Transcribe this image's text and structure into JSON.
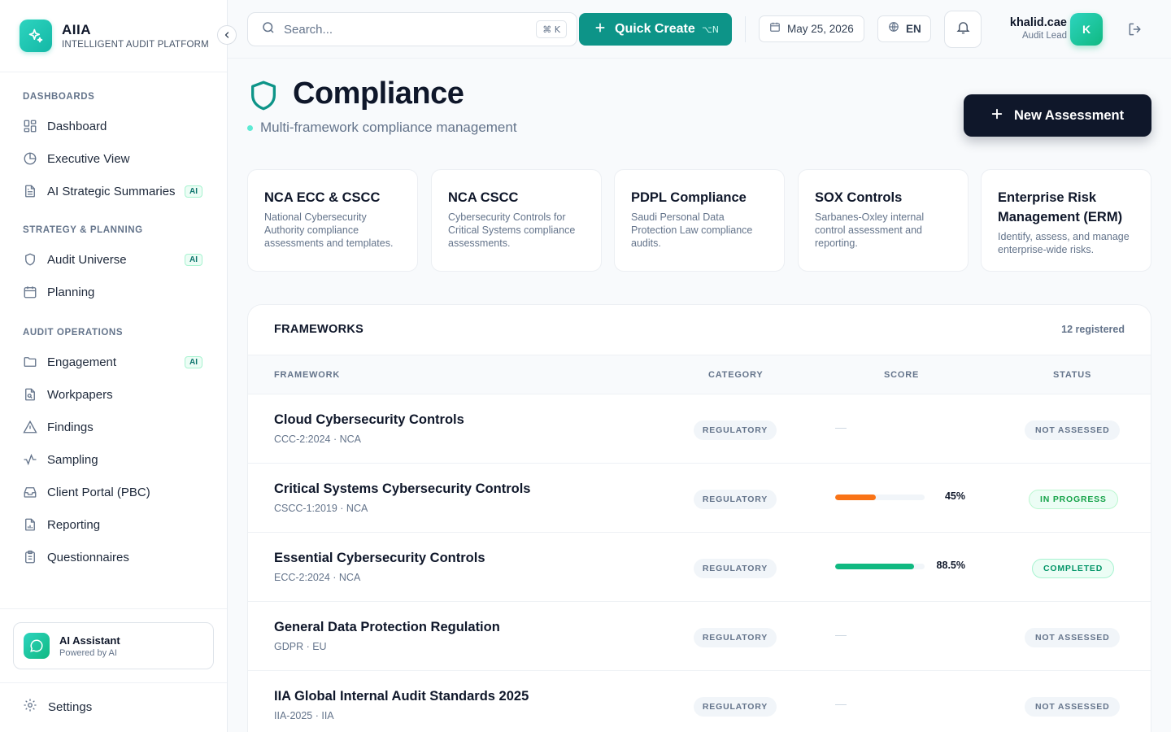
{
  "brand": {
    "name": "AIIA",
    "subtitle": "INTELLIGENT AUDIT PLATFORM"
  },
  "sidebar": {
    "sections": [
      {
        "title": "DASHBOARDS",
        "items": [
          {
            "label": "Dashboard",
            "icon": "grid-icon",
            "ai": false
          },
          {
            "label": "Executive View",
            "icon": "pie-chart-icon",
            "ai": false
          },
          {
            "label": "AI Strategic Summaries",
            "icon": "document-icon",
            "ai": true
          }
        ]
      },
      {
        "title": "STRATEGY & PLANNING",
        "items": [
          {
            "label": "Audit Universe",
            "icon": "shield-icon",
            "ai": true
          },
          {
            "label": "Planning",
            "icon": "calendar-icon",
            "ai": false
          }
        ]
      },
      {
        "title": "AUDIT OPERATIONS",
        "items": [
          {
            "label": "Engagement",
            "icon": "folder-icon",
            "ai": true
          },
          {
            "label": "Workpapers",
            "icon": "file-search-icon",
            "ai": false
          },
          {
            "label": "Findings",
            "icon": "warning-icon",
            "ai": false
          },
          {
            "label": "Sampling",
            "icon": "activity-icon",
            "ai": false
          },
          {
            "label": "Client Portal (PBC)",
            "icon": "inbox-icon",
            "ai": false
          },
          {
            "label": "Reporting",
            "icon": "report-icon",
            "ai": false
          },
          {
            "label": "Questionnaires",
            "icon": "clipboard-icon",
            "ai": false
          }
        ]
      }
    ],
    "ai_badge": "AI",
    "assistant": {
      "title": "AI Assistant",
      "subtitle": "Powered by AI"
    },
    "settings_label": "Settings"
  },
  "topbar": {
    "search_placeholder": "Search...",
    "search_shortcut": "⌘ K",
    "quick_create": "Quick Create",
    "quick_create_shortcut": "⌥N",
    "date": "May 25, 2026",
    "language": "EN",
    "user": {
      "name": "khalid.cae",
      "role": "Audit Lead",
      "initial": "K"
    }
  },
  "page": {
    "title": "Compliance",
    "subtitle": "Multi-framework compliance management",
    "new_button": "New Assessment"
  },
  "cards": [
    {
      "title": "NCA ECC & CSCC",
      "desc": "National Cybersecurity Authority compliance assessments and templates."
    },
    {
      "title": "NCA CSCC",
      "desc": "Cybersecurity Controls for Critical Systems compliance assessments."
    },
    {
      "title": "PDPL Compliance",
      "desc": "Saudi Personal Data Protection Law compliance audits."
    },
    {
      "title": "SOX Controls",
      "desc": "Sarbanes-Oxley internal control assessment and reporting."
    },
    {
      "title": "Enterprise Risk Management (ERM)",
      "desc": "Identify, assess, and manage enterprise-wide risks."
    }
  ],
  "frameworks": {
    "title": "FRAMEWORKS",
    "count": "12 registered",
    "columns": {
      "framework": "FRAMEWORK",
      "category": "CATEGORY",
      "score": "SCORE",
      "status": "STATUS"
    },
    "rows": [
      {
        "name": "Cloud Cybersecurity Controls",
        "code": "CCC-2:2024 · NCA",
        "category": "REGULATORY",
        "score": null,
        "score_label": "—",
        "status": "NOT ASSESSED",
        "status_type": "none"
      },
      {
        "name": "Critical Systems Cybersecurity Controls",
        "code": "CSCC-1:2019 · NCA",
        "category": "REGULATORY",
        "score": 45,
        "score_label": "45%",
        "score_color": "#f97316",
        "status": "IN PROGRESS",
        "status_type": "prog"
      },
      {
        "name": "Essential Cybersecurity Controls",
        "code": "ECC-2:2024 · NCA",
        "category": "REGULATORY",
        "score": 88.5,
        "score_label": "88.5%",
        "score_color": "#10b981",
        "status": "COMPLETED",
        "status_type": "done"
      },
      {
        "name": "General Data Protection Regulation",
        "code": "GDPR · EU",
        "category": "REGULATORY",
        "score": null,
        "score_label": "—",
        "status": "NOT ASSESSED",
        "status_type": "none"
      },
      {
        "name": "IIA Global Internal Audit Standards 2025",
        "code": "IIA-2025 · IIA",
        "category": "REGULATORY",
        "score": null,
        "score_label": "—",
        "status": "NOT ASSESSED",
        "status_type": "none"
      }
    ]
  },
  "colors": {
    "accent": "#0d9488",
    "dark": "#0f172a",
    "brand_gradient_start": "#2dd4bf",
    "brand_gradient_end": "#10b981"
  }
}
